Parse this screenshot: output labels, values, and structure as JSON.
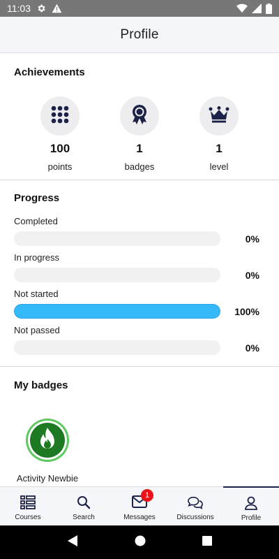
{
  "status_bar": {
    "time": "11:03"
  },
  "app_bar": {
    "title": "Profile"
  },
  "achievements": {
    "title": "Achievements",
    "items": [
      {
        "icon": "grid-icon",
        "value": "100",
        "label": "points"
      },
      {
        "icon": "award-icon",
        "value": "1",
        "label": "badges"
      },
      {
        "icon": "crown-icon",
        "value": "1",
        "label": "level"
      }
    ]
  },
  "progress": {
    "title": "Progress",
    "fill_color": "#36b9f9",
    "items": [
      {
        "label": "Completed",
        "percent": 0,
        "percent_text": "0%"
      },
      {
        "label": "In progress",
        "percent": 0,
        "percent_text": "0%"
      },
      {
        "label": "Not started",
        "percent": 100,
        "percent_text": "100%"
      },
      {
        "label": "Not passed",
        "percent": 0,
        "percent_text": "0%"
      }
    ]
  },
  "badges": {
    "title": "My badges",
    "items": [
      {
        "icon": "flame-badge-icon",
        "label": "Activity Newbie",
        "color": "#1e7a22"
      }
    ]
  },
  "bottom_nav": {
    "active_color": "#1c2247",
    "items": [
      {
        "icon": "courses-icon",
        "label": "Courses"
      },
      {
        "icon": "search-icon",
        "label": "Search"
      },
      {
        "icon": "mail-icon",
        "label": "Messages",
        "badge": "1"
      },
      {
        "icon": "discussions-icon",
        "label": "Discussions"
      },
      {
        "icon": "person-icon",
        "label": "Profile"
      }
    ]
  }
}
